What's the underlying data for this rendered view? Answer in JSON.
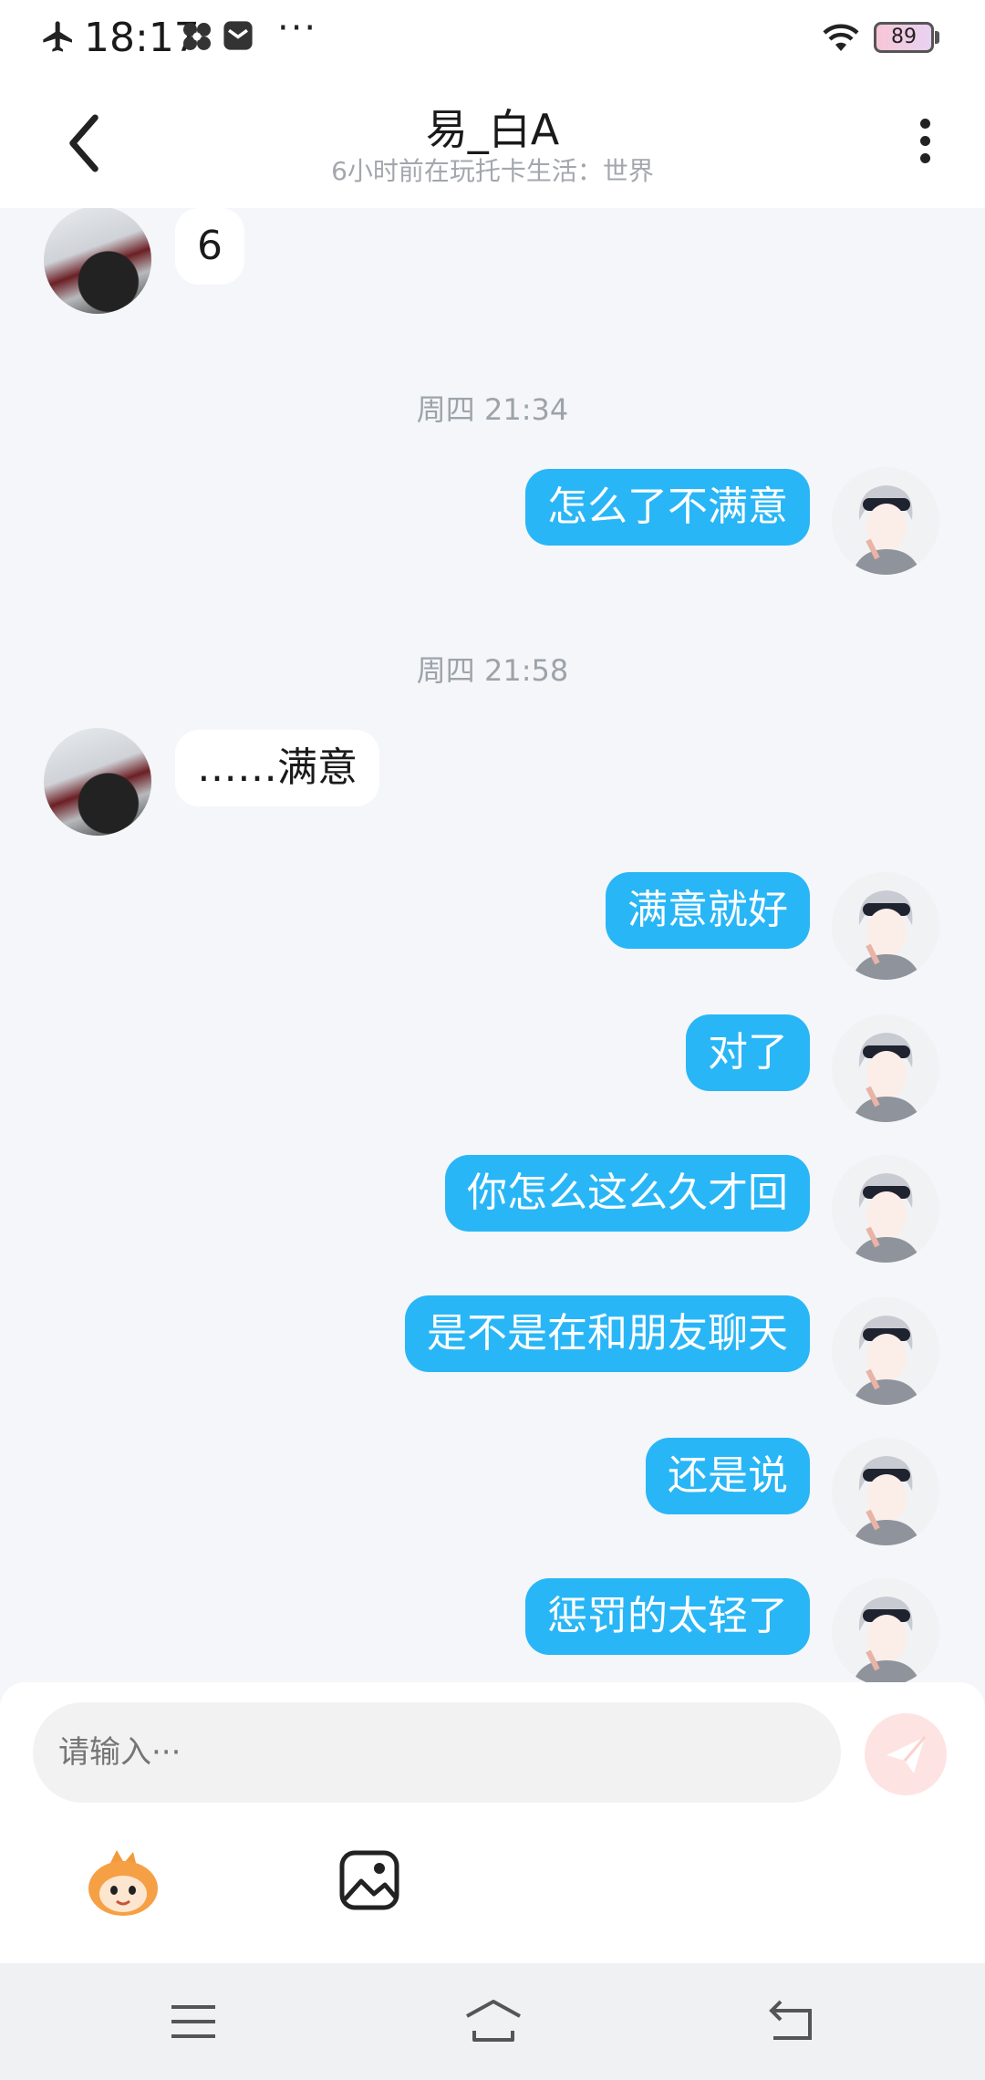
{
  "status_bar": {
    "time": "18:17",
    "more": "···",
    "battery": "89"
  },
  "header": {
    "title": "易_白A",
    "subtitle": "6小时前在玩托卡生活：世界"
  },
  "messages": [
    {
      "side": "other",
      "text": "6"
    },
    {
      "side": "ts",
      "text": "周四 21:34"
    },
    {
      "side": "me",
      "text": "怎么了不满意"
    },
    {
      "side": "ts",
      "text": "周四 21:58"
    },
    {
      "side": "other",
      "text": "……满意"
    },
    {
      "side": "me",
      "text": "满意就好"
    },
    {
      "side": "me",
      "text": "对了"
    },
    {
      "side": "me",
      "text": "你怎么这么久才回"
    },
    {
      "side": "me",
      "text": "是不是在和朋友聊天"
    },
    {
      "side": "me",
      "text": "还是说"
    },
    {
      "side": "me",
      "text": "惩罚的太轻了"
    }
  ],
  "input": {
    "placeholder": "请输入···"
  },
  "colors": {
    "bubble_me": "#29b6f6",
    "bubble_other": "#ffffff",
    "background": "#f4f6f9",
    "send_button": "#fde3e1"
  },
  "icons": [
    "airplane-icon",
    "app-icon",
    "message-icon",
    "wifi-icon",
    "battery-icon",
    "back-arrow-icon",
    "more-vert-icon",
    "send-icon",
    "emoji-icon",
    "image-icon",
    "menu-icon",
    "home-icon",
    "back-icon"
  ]
}
